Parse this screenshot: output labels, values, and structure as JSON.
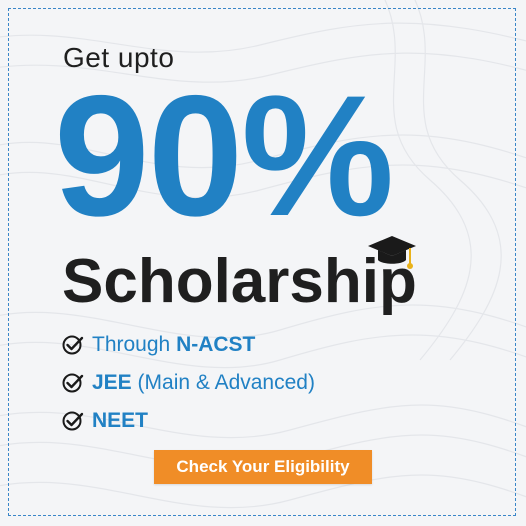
{
  "banner": {
    "pre_title": "Get upto",
    "headline_value": "90%",
    "headline_label": "Scholarship",
    "features": [
      {
        "prefix": "Through ",
        "highlight": "N-ACST",
        "suffix": ""
      },
      {
        "prefix": "",
        "highlight": "JEE",
        "suffix": " (Main & Advanced)"
      },
      {
        "prefix": "",
        "highlight": "NEET",
        "suffix": ""
      }
    ],
    "cta_label": "Check Your Eligibility"
  },
  "icons": {
    "graduation": "graduation-cap-icon",
    "check": "check-circle-icon"
  },
  "colors": {
    "accent_blue": "#2181c4",
    "cta_orange": "#f08d27",
    "text_dark": "#1f1f1f",
    "background": "#f4f5f7",
    "frame_border": "#3a86c8"
  }
}
